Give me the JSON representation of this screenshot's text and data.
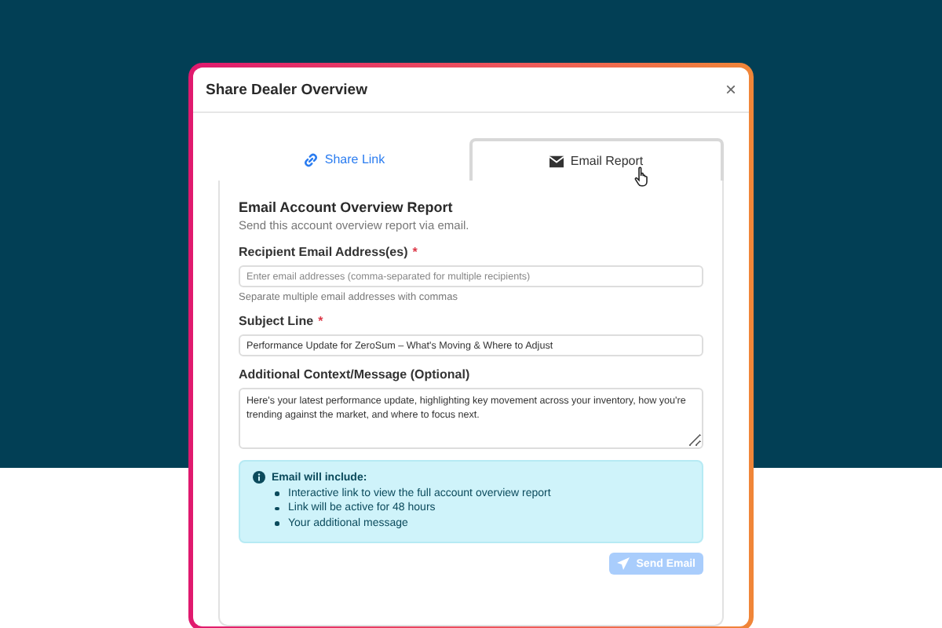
{
  "dialog": {
    "title": "Share Dealer Overview",
    "close": "×"
  },
  "tabs": [
    {
      "label": "Share Link",
      "kind": "link",
      "selected": false
    },
    {
      "label": "Email Report",
      "kind": "email",
      "selected": true
    }
  ],
  "form": {
    "heading": "Email Account Overview Report",
    "subheading": "Send this account overview report via email.",
    "fields": [
      {
        "kind": "input",
        "label": "Recipient Email Address(es)",
        "required_mark": "*",
        "placeholder": "Enter email addresses (comma-separated for multiple recipients)",
        "help": "Separate multiple email addresses with commas"
      },
      {
        "kind": "input",
        "label": "Subject Line",
        "required_mark": "*",
        "value": "Performance Update for ZeroSum – What's Moving & Where to Adjust"
      },
      {
        "kind": "textarea",
        "label": "Additional Context/Message (Optional)",
        "value": "Here's your latest performance update, highlighting key movement across your inventory, how you're trending against the market, and where to focus next."
      }
    ],
    "info": {
      "title": "Email will include:",
      "items": [
        "Interactive link to view the full account overview report",
        "Link will be active for 48 hours",
        "Your additional message"
      ]
    },
    "submit": {
      "label": "Send Email",
      "disabled": true
    }
  }
}
